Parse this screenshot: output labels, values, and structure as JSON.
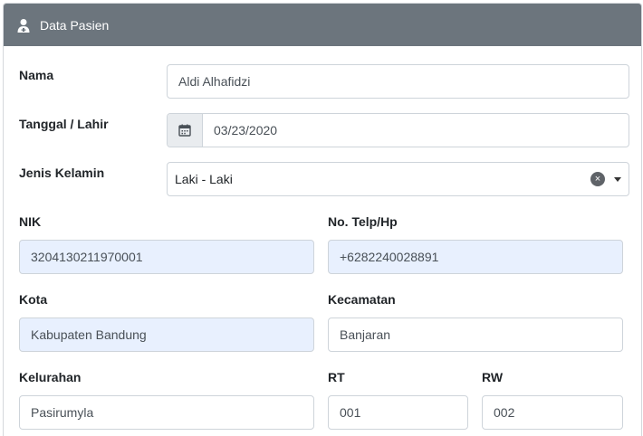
{
  "header": {
    "title": "Data Pasien",
    "icon": "user-doctor-icon"
  },
  "form": {
    "nama": {
      "label": "Nama",
      "value": "Aldi Alhafidzi"
    },
    "tanggal": {
      "label": "Tanggal / Lahir",
      "value": "03/23/2020",
      "icon": "calendar-icon"
    },
    "jenis_kelamin": {
      "label": "Jenis Kelamin",
      "value": "Laki - Laki",
      "clear": "×"
    },
    "nik": {
      "label": "NIK",
      "value": "3204130211970001"
    },
    "telp": {
      "label": "No. Telp/Hp",
      "value": "+6282240028891"
    },
    "kota": {
      "label": "Kota",
      "value": "Kabupaten Bandung"
    },
    "kecamatan": {
      "label": "Kecamatan",
      "value": "Banjaran"
    },
    "kelurahan": {
      "label": "Kelurahan",
      "value": "Pasirumyla"
    },
    "rt": {
      "label": "RT",
      "value": "001"
    },
    "rw": {
      "label": "RW",
      "value": "002"
    }
  },
  "colors": {
    "header_bg": "#6c757d",
    "autofill_bg": "#e8f0fe",
    "border": "#ced4da"
  }
}
